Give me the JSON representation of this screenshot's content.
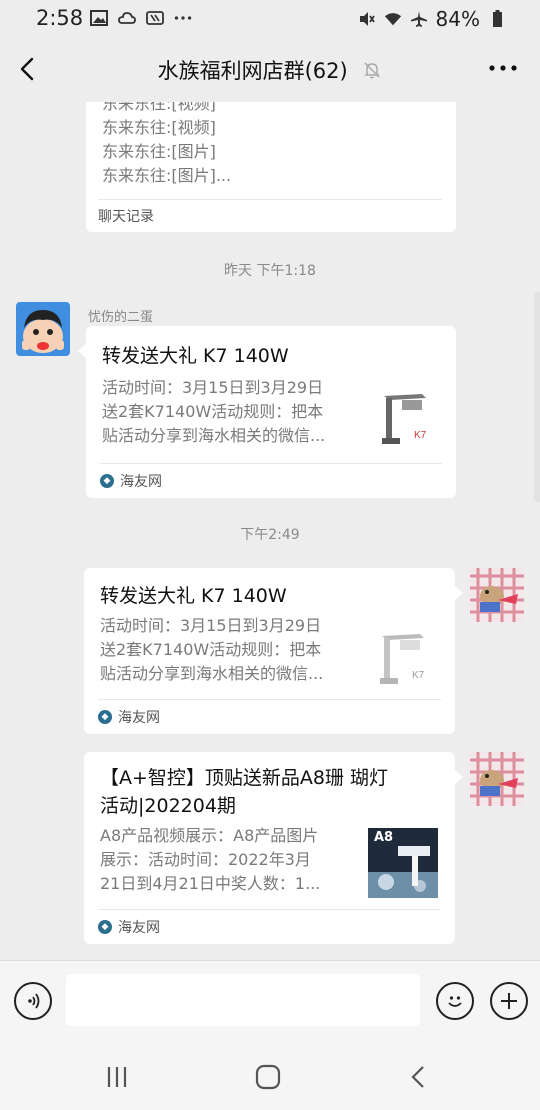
{
  "status_bar": {
    "time": "2:58",
    "icons_left": [
      "image-icon",
      "cloud-icon",
      "nfc-icon",
      "more-dots-icon"
    ],
    "icons_right": [
      "mute-icon",
      "wifi-icon",
      "airplane-icon",
      "battery-icon"
    ],
    "battery": "84%"
  },
  "header": {
    "title": "水族福利网店群(62)"
  },
  "messages": {
    "chat_record": {
      "lines": [
        "东来东往:[视频]",
        "东来东往:[视频]",
        "东来东往:[图片]",
        "东来东往:[图片]..."
      ],
      "footer": "聊天记录"
    },
    "time1": "昨天 下午1:18",
    "msg1": {
      "sender": "忧伤的二蛋",
      "title": "转发送大礼  K7 140W",
      "desc": [
        "活动时间：3月15日到3月29日",
        "送2套K7140W活动规则：把本",
        "贴活动分享到海水相关的微信..."
      ],
      "source": "海友网"
    },
    "time2": "下午2:49",
    "msg2": {
      "title": "转发送大礼  K7 140W",
      "desc": [
        "活动时间：3月15日到3月29日",
        "送2套K7140W活动规则：把本",
        "贴活动分享到海水相关的微信..."
      ],
      "source": "海友网"
    },
    "msg3": {
      "title": [
        "【A+智控】顶贴送新品A8珊 瑚灯",
        "活动|202204期"
      ],
      "desc": [
        "A8产品视频展示：A8产品图片",
        "展示：活动时间：2022年3月",
        "21日到4月21日中奖人数：1..."
      ],
      "source": "海友网",
      "thumb_label": "A8"
    }
  },
  "input": {
    "placeholder": ""
  },
  "colors": {
    "background": "#ededed",
    "bubble": "#ffffff",
    "muted_text": "#7a7a7a"
  }
}
